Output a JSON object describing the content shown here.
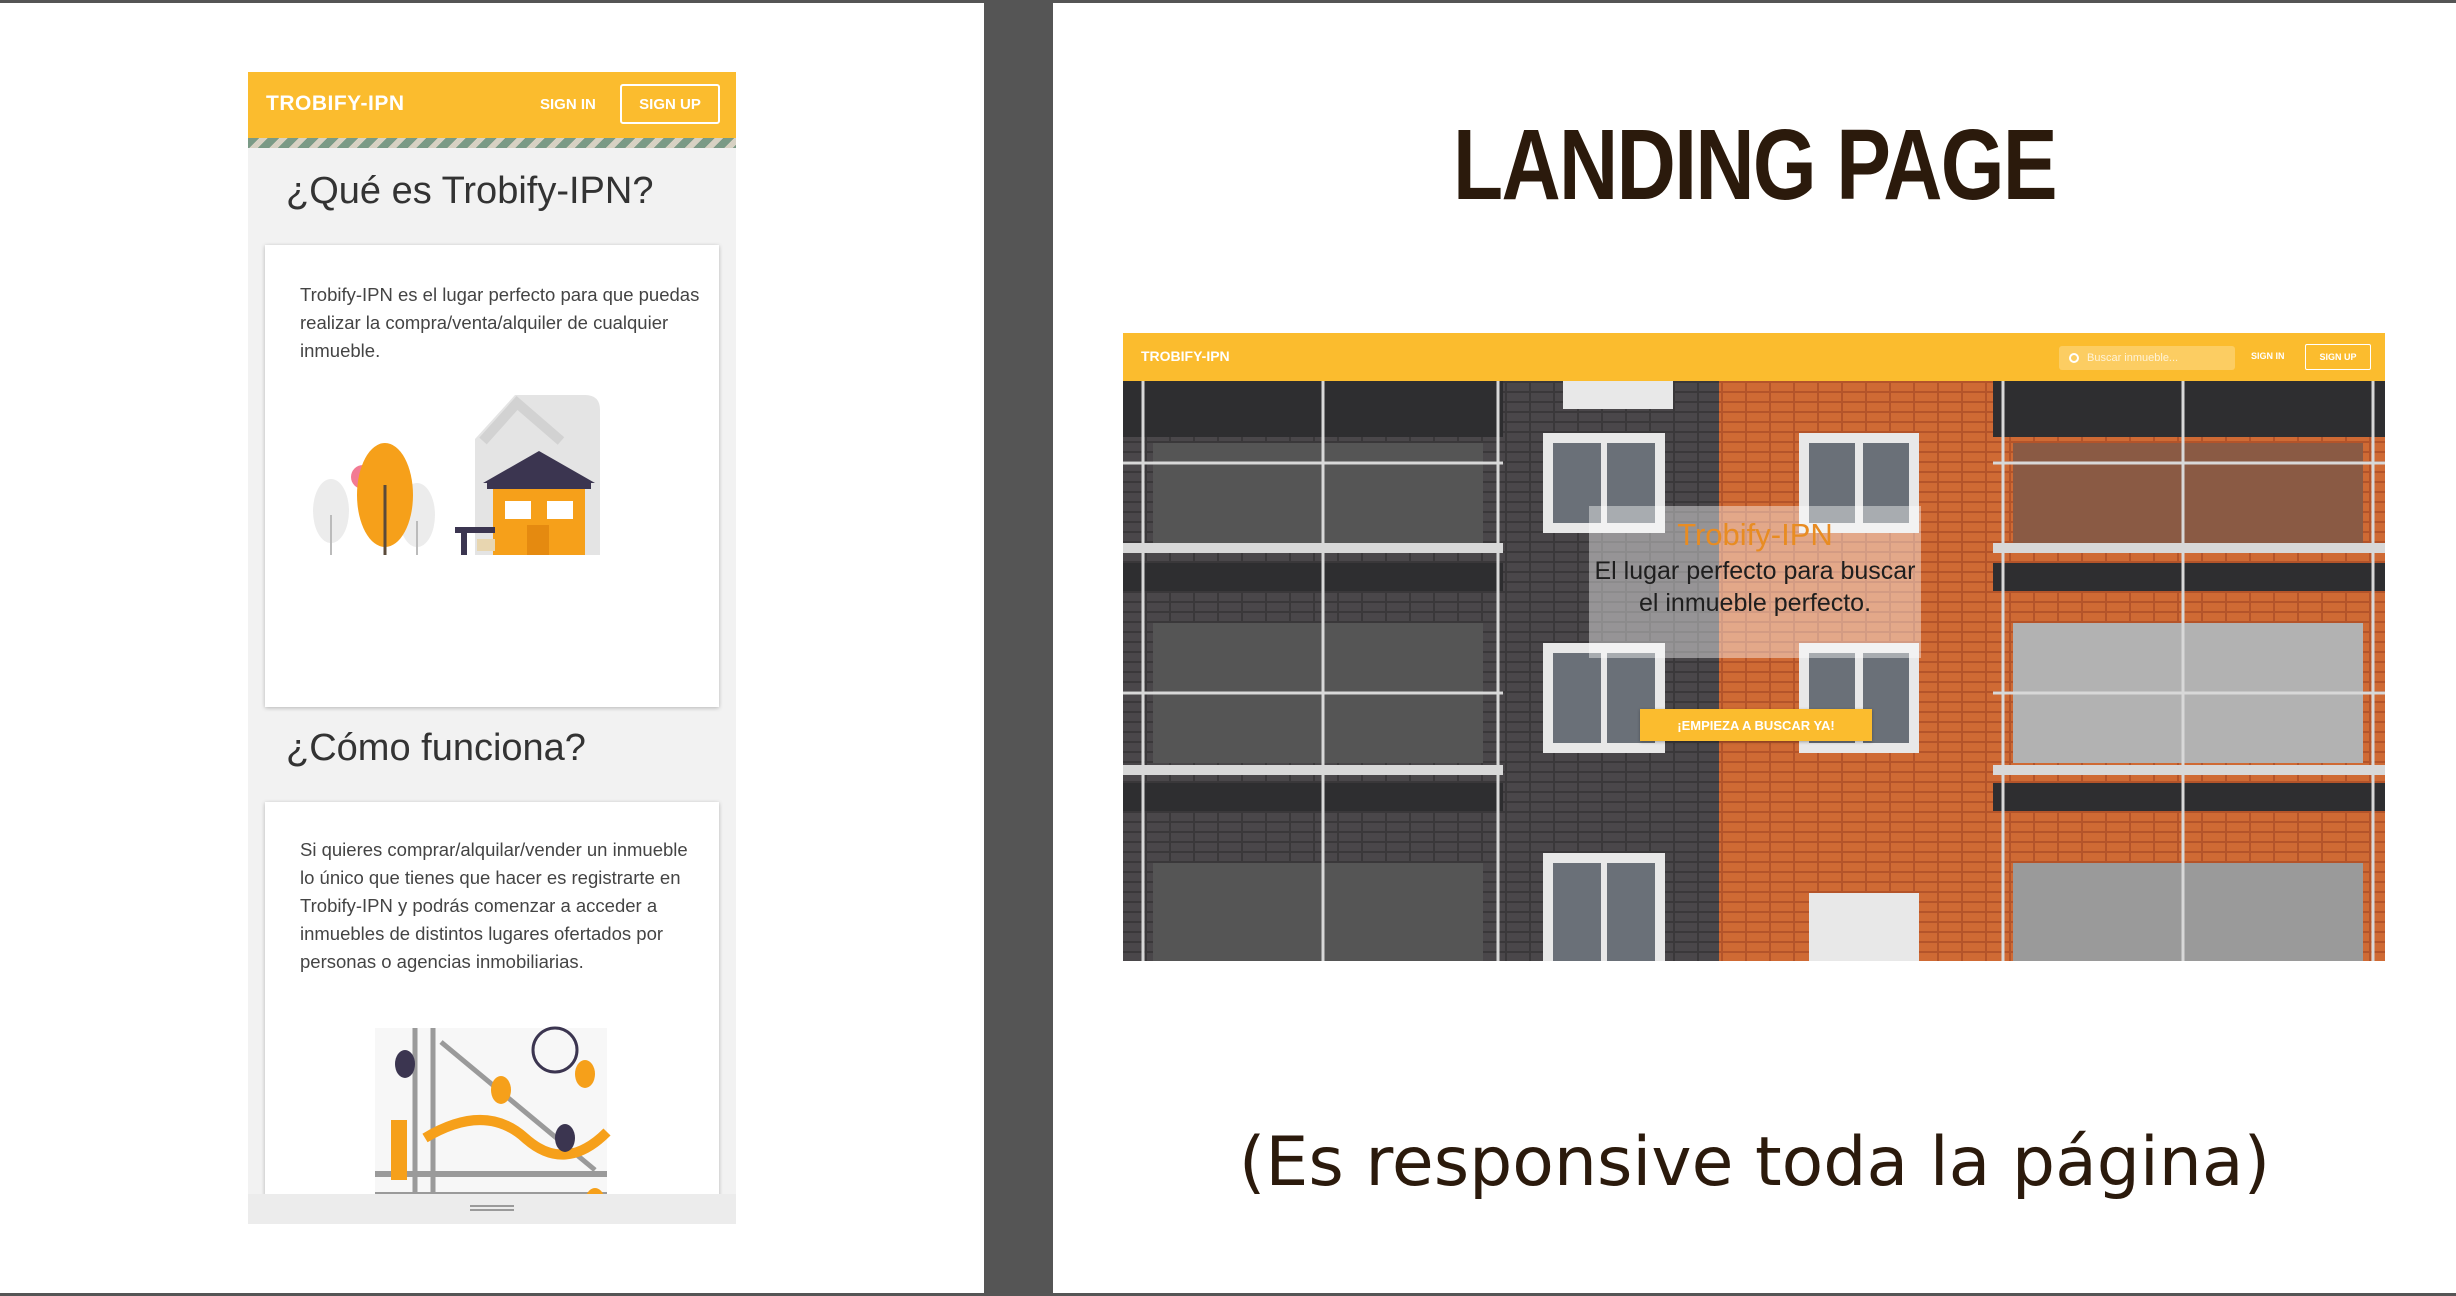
{
  "mobile": {
    "brand": "TROBIFY-IPN",
    "nav_signin": "SIGN IN",
    "nav_signup": "SIGN UP",
    "section1_title": "¿Qué es Trobify-IPN?",
    "section1_text": "Trobify-IPN es el lugar perfecto para que puedas realizar la compra/venta/alquiler de cualquier inmueble.",
    "section2_title": "¿Cómo funciona?",
    "section2_text": "Si quieres comprar/alquilar/vender un inmueble lo único que tienes que hacer es registrarte en Trobify-IPN y podrás comenzar a acceder a inmuebles de distintos lugares ofertados por personas o agencias inmobiliarias."
  },
  "slide": {
    "title": "LANDING PAGE",
    "caption": "(Es responsive toda la página)"
  },
  "desktop": {
    "brand": "TROBIFY-IPN",
    "search_placeholder": "Buscar inmueble...",
    "nav_signin": "SIGN IN",
    "nav_signup": "SIGN UP",
    "hero_title": "Trobify-IPN",
    "hero_subtitle": "El lugar perfecto para buscar el inmueble perfecto.",
    "hero_button": "¡EMPIEZA A BUSCAR YA!"
  },
  "colors": {
    "brand_yellow": "#fbbc2e",
    "accent_orange": "#e88c22",
    "title_brown": "#2b1a0c"
  }
}
